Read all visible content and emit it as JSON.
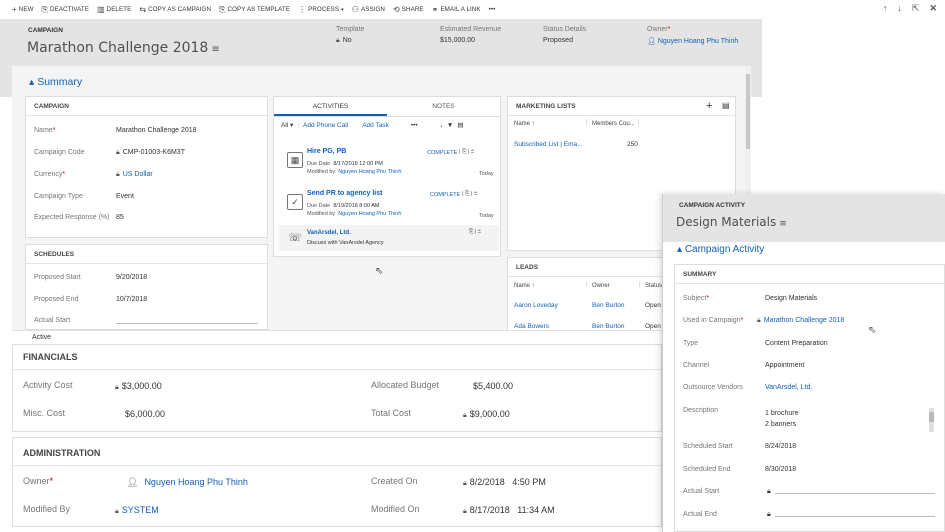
{
  "commands": [
    {
      "icon": "+",
      "label": "NEW",
      "name": "new-button"
    },
    {
      "icon": "⎘",
      "label": "DEACTIVATE",
      "name": "deactivate-button"
    },
    {
      "icon": "🗑",
      "label": "DELETE",
      "name": "delete-button"
    },
    {
      "icon": "⇆",
      "label": "COPY AS CAMPAIGN",
      "name": "copy-as-campaign-button"
    },
    {
      "icon": "⎘",
      "label": "COPY AS TEMPLATE",
      "name": "copy-as-template-button"
    },
    {
      "icon": "⋮",
      "label": "PROCESS",
      "name": "process-button"
    },
    {
      "icon": "⚇",
      "label": "ASSIGN",
      "name": "assign-button"
    },
    {
      "icon": "⟲",
      "label": "SHARE",
      "name": "share-button"
    },
    {
      "icon": "⚭",
      "label": "EMAIL A LINK",
      "name": "email-link-button"
    },
    {
      "icon": "",
      "label": "•••",
      "name": "more-commands-button"
    }
  ],
  "header": {
    "entity": "CAMPAIGN",
    "title": "Marathon Challenge 2018",
    "template_label": "Template",
    "template_value": "No",
    "revenue_label": "Estimated Revenue",
    "revenue_value": "$15,000.00",
    "status_label": "Status Details",
    "status_value": "Proposed",
    "owner_label": "Owner",
    "owner_value": "Nguyen Hoang Phu Thinh"
  },
  "summary_label": "Summary",
  "campaign_card": {
    "title": "CAMPAIGN",
    "name_label": "Name",
    "name_value": "Marathon Challenge 2018",
    "code_label": "Campaign Code",
    "code_value": "CMP-01003-K6M3T",
    "currency_label": "Currency",
    "currency_value": "US Dollar",
    "type_label": "Campaign Type",
    "type_value": "Event",
    "response_label": "Expected Response (%)",
    "response_value": "85"
  },
  "schedules": {
    "title": "SCHEDULES",
    "start_label": "Proposed Start",
    "start_value": "9/20/2018",
    "end_label": "Proposed End",
    "end_value": "10/7/2018",
    "actual_label": "Actual Start"
  },
  "status_bar": "Active",
  "activities": {
    "tab_activities": "ACTIVITIES",
    "tab_notes": "NOTES",
    "filter": "All",
    "add_phone": "Add Phone Call",
    "add_task": "Add Task",
    "more": "•••",
    "items": [
      {
        "title": "Hire PG, PB",
        "due_label": "Due Date",
        "due": "8/17/2018 12:00 PM",
        "mod_label": "Modified by",
        "mod_by": "Nguyen Hoang Phu Thinh",
        "status": "COMPLETE",
        "when": "Today"
      },
      {
        "title": "Send PR to agency list",
        "due_label": "Due Date",
        "due": "8/19/2018 8:00 AM",
        "mod_label": "Modified by",
        "mod_by": "Nguyen Hoang Phu Thinh",
        "status": "COMPLETE",
        "when": "Today"
      },
      {
        "title": "VanArsdel, Ltd.",
        "desc": "Discuss with VanArsdel Agency"
      }
    ]
  },
  "marketing_lists": {
    "title": "MARKETING LISTS",
    "col_name": "Name ↑",
    "col_members": "Members Cou...",
    "rows": [
      {
        "name": "Subscribed List | Ema...",
        "members": "250"
      }
    ]
  },
  "leads": {
    "title": "LEADS",
    "col_name": "Name ↑",
    "col_owner": "Owner",
    "col_status": "Status",
    "rows": [
      {
        "name": "Aaron Loveday",
        "owner": "Ben Burton",
        "status": "Open"
      },
      {
        "name": "Ada Bowers",
        "owner": "Ben Burton",
        "status": "Open"
      }
    ]
  },
  "financials": {
    "title": "FINANCIALS",
    "activity_cost_label": "Activity Cost",
    "activity_cost": "$3,000.00",
    "budget_label": "Allocated Budget",
    "budget": "$5,400.00",
    "misc_label": "Misc. Cost",
    "misc": "$6,000.00",
    "total_label": "Total Cost",
    "total": "$9,000.00"
  },
  "administration": {
    "title": "ADMINISTRATION",
    "owner_label": "Owner",
    "owner": "Nguyen Hoang Phu Thinh",
    "created_label": "Created On",
    "created_date": "8/2/2018",
    "created_time": "4:50 PM",
    "modby_label": "Modified By",
    "modby": "SYSTEM",
    "modon_label": "Modified On",
    "modon_date": "8/17/2018",
    "modon_time": "11:34 AM"
  },
  "panel": {
    "entity": "CAMPAIGN ACTIVITY",
    "title": "Design Materials",
    "section": "Campaign Activity",
    "card_title": "SUMMARY",
    "subject_label": "Subject",
    "subject": "Design Materials",
    "used_label": "Used in Campaign",
    "used": "Marathon Challenge 2018",
    "type_label": "Type",
    "type": "Content Preparation",
    "channel_label": "Channel",
    "channel": "Appointment",
    "vendors_label": "Outsource Vendors",
    "vendors": "VanArsdel, Ltd.",
    "desc_label": "Description",
    "desc1": "1 brochure",
    "desc2": "2 banners",
    "sstart_label": "Scheduled Start",
    "sstart": "8/24/2018",
    "send_label": "Scheduled End",
    "send": "8/30/2018",
    "astart_label": "Actual Start",
    "aend_label": "Actual End"
  }
}
